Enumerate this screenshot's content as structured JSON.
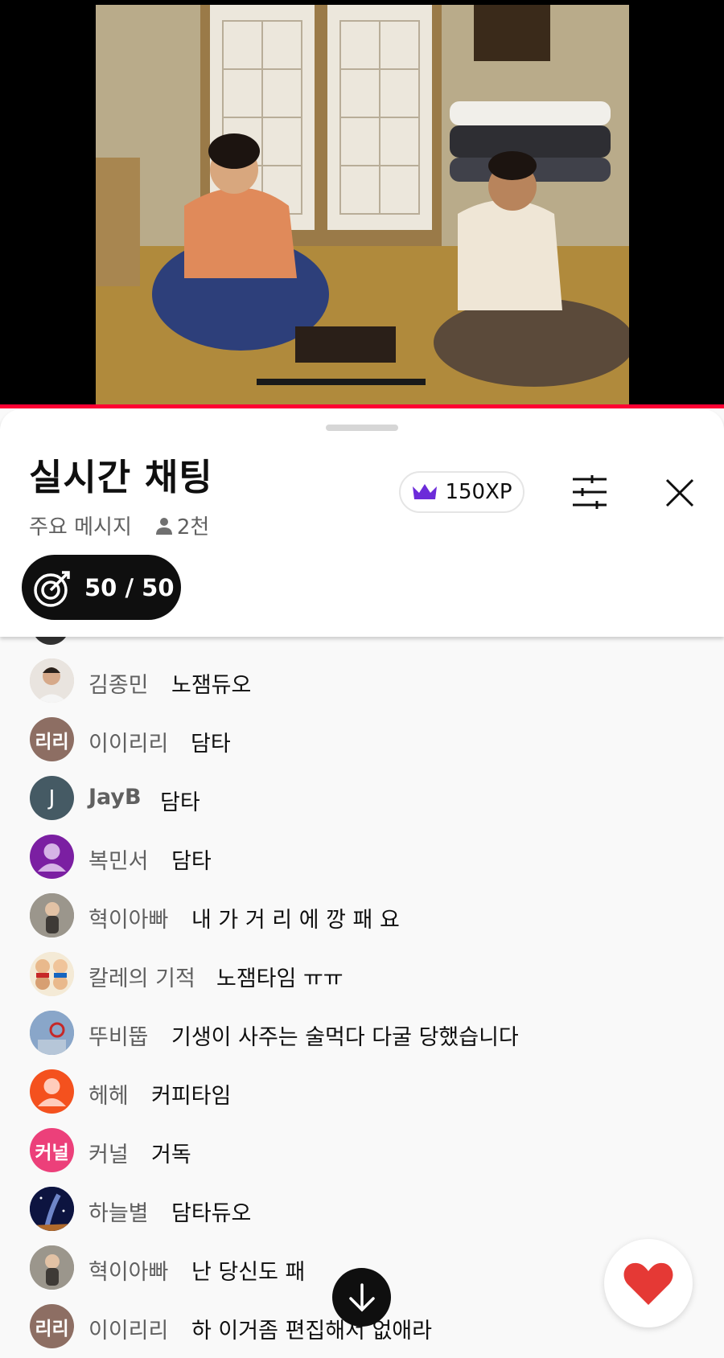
{
  "chat": {
    "title": "실시간 채팅",
    "mode": "주요 메시지",
    "viewers": "2천",
    "xp": "150XP",
    "goal": "50 / 50"
  },
  "colors": {
    "accent": "#ff0033",
    "crown": "#6c2bd9"
  },
  "messages": [
    {
      "author": "김종민",
      "text": "노잼듀오",
      "avatar_text": "",
      "avatar_color": "#c9b8a6"
    },
    {
      "author": "이이리리",
      "text": "담타",
      "avatar_text": "리리",
      "avatar_color": "#8d6e63"
    },
    {
      "author": "JayB",
      "text": "담타",
      "avatar_text": "J",
      "avatar_color": "#455a64"
    },
    {
      "author": "복민서",
      "text": "담타",
      "avatar_text": "",
      "avatar_color": "#7b1fa2"
    },
    {
      "author": "혁이아빠",
      "text": "내 가 거 리 에 깡 패 요",
      "avatar_text": "",
      "avatar_color": "#6d6a63"
    },
    {
      "author": "칼레의 기적",
      "text": "노잼타임 ㅠㅠ",
      "avatar_text": "",
      "avatar_color": "#e9d8b4"
    },
    {
      "author": "뚜비뚭",
      "text": "기생이 사주는 술먹다 다굴 당했습니다",
      "avatar_text": "",
      "avatar_color": "#6e8fb5"
    },
    {
      "author": "헤헤",
      "text": "커피타임",
      "avatar_text": "",
      "avatar_color": "#f4511e"
    },
    {
      "author": "커널",
      "text": "거독",
      "avatar_text": "커널",
      "avatar_color": "#ec407a"
    },
    {
      "author": "하늘별",
      "text": "담타듀오",
      "avatar_text": "",
      "avatar_color": "#1a237e"
    },
    {
      "author": "혁이아빠",
      "text": "난 당신도 패",
      "avatar_text": "",
      "avatar_color": "#6d6a63"
    },
    {
      "author": "이이리리",
      "text": "하 이거좀 편집해서 없애라",
      "avatar_text": "리리",
      "avatar_color": "#8d6e63"
    }
  ]
}
